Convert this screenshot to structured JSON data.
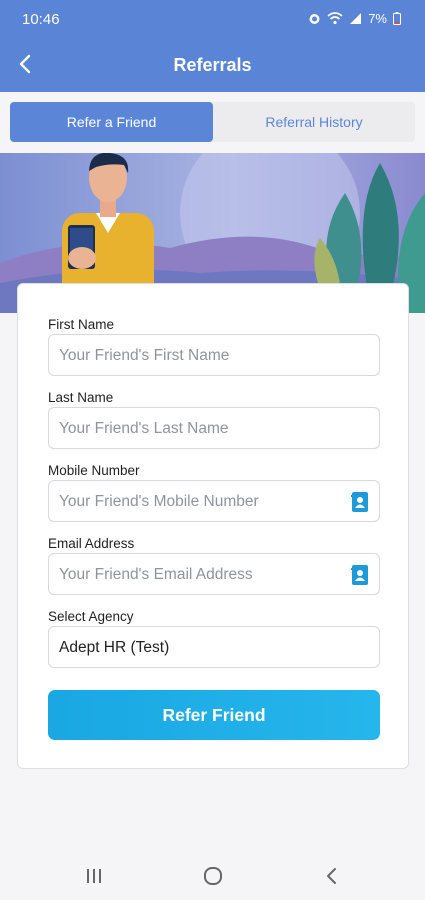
{
  "status_bar": {
    "time": "10:46",
    "battery": "7%"
  },
  "header": {
    "title": "Referrals",
    "back_icon": "chevron-left-icon"
  },
  "tabs": [
    {
      "label": "Refer a Friend",
      "active": true
    },
    {
      "label": "Referral History",
      "active": false
    }
  ],
  "form": {
    "fields": [
      {
        "label": "First Name",
        "placeholder": "Your Friend's First Name",
        "value": ""
      },
      {
        "label": "Last Name",
        "placeholder": "Your Friend's Last Name",
        "value": ""
      },
      {
        "label": "Mobile Number",
        "placeholder": "Your Friend's Mobile Number",
        "value": "",
        "icon": "contact-book-icon"
      },
      {
        "label": "Email Address",
        "placeholder": "Your Friend's Email Address",
        "value": "",
        "icon": "contact-book-icon"
      },
      {
        "label": "Select Agency",
        "placeholder": "",
        "value": "Adept HR (Test)"
      }
    ],
    "submit_label": "Refer Friend"
  },
  "colors": {
    "header_blue": "#5a84d6",
    "tab_active": "#5b86d8",
    "button_blue": "#1aa7e2",
    "icon_blue": "#1e9bd7"
  }
}
